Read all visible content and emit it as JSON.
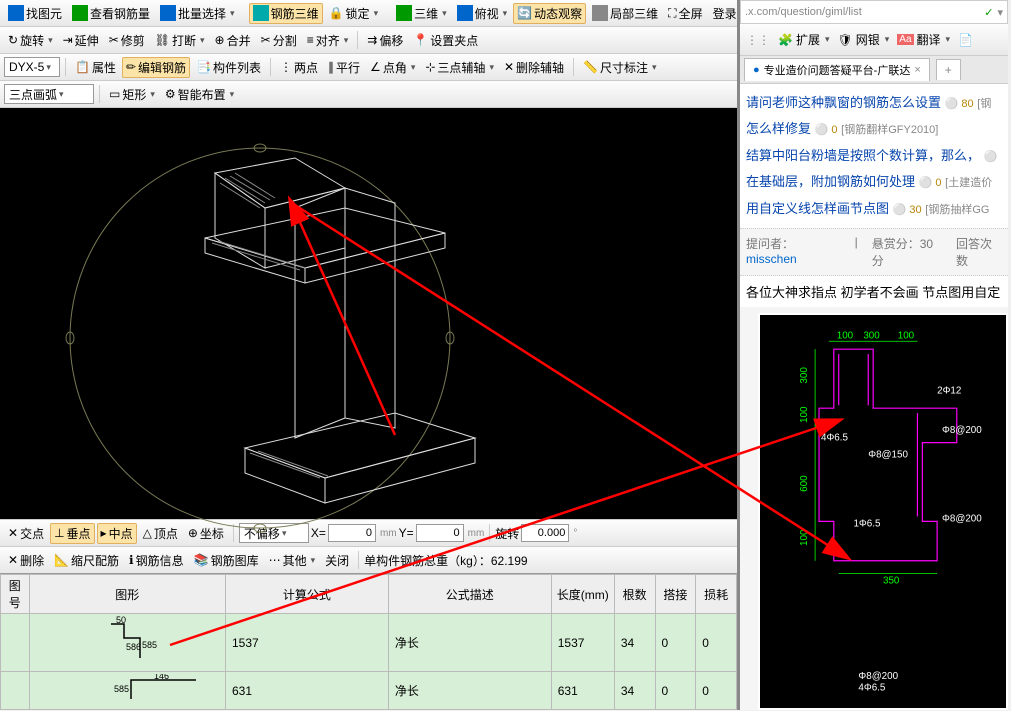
{
  "toolbar1": {
    "findView": "找图元",
    "viewRebar": "查看钢筋量",
    "batchSelect": "批量选择",
    "rebar3d": "钢筋三维",
    "lock": "锁定",
    "3d": "三维",
    "topView": "俯视",
    "dynObserve": "动态观察",
    "local3d": "局部三维",
    "fullScreen": "全屏",
    "login": "登录"
  },
  "toolbar2": {
    "rotate": "旋转",
    "extend": "延伸",
    "trim": "修剪",
    "break": "打断",
    "merge": "合并",
    "split": "分割",
    "align": "对齐",
    "offset": "偏移",
    "setClamp": "设置夹点"
  },
  "toolbar3": {
    "selector": "DYX-5",
    "attr": "属性",
    "editRebar": "编辑钢筋",
    "memberList": "构件列表",
    "twoPoint": "两点",
    "parallel": "平行",
    "pointAngle": "点角",
    "threePointAxis": "三点辅轴",
    "deleteAux": "删除辅轴",
    "dimMark": "尺寸标注"
  },
  "toolbar4": {
    "threePointArc": "三点画弧",
    "rect": "矩形",
    "smartArrange": "智能布置"
  },
  "snap": {
    "intersect": "交点",
    "perp": "垂点",
    "midpoint": "中点",
    "vertex": "顶点",
    "coord": "坐标",
    "noOffset": "不偏移",
    "x": "X=",
    "xval": "0",
    "y": "Y=",
    "yval": "0",
    "rot": "旋转",
    "rotval": "0.000",
    "mm": "mm"
  },
  "infobar": {
    "delete": "删除",
    "rulerMatch": "缩尺配筋",
    "rebarInfo": "钢筋信息",
    "rebarLib": "钢筋图库",
    "other": "其他",
    "close": "关闭",
    "totalLabel": "单构件钢筋总重（kg）：",
    "totalVal": "62.199"
  },
  "table": {
    "headers": [
      "图号",
      "图形",
      "计算公式",
      "公式描述",
      "长度(mm)",
      "根数",
      "搭接",
      "损耗"
    ],
    "rows": [
      {
        "formula": "1537",
        "desc": "净长",
        "len": "1537",
        "count": "34",
        "lap": "0",
        "loss": "0",
        "shapeTop": "50",
        "shapeSide": "585",
        "shapeSide2": "586"
      },
      {
        "formula": "631",
        "desc": "净长",
        "len": "631",
        "count": "34",
        "lap": "0",
        "loss": "0",
        "shapeSide": "585",
        "shapeTop": "146"
      }
    ]
  },
  "right": {
    "url": ".x.com/question/giml/list",
    "expand": "扩展",
    "netSilver": "网银",
    "translate": "翻译",
    "tabTitle": "专业造价问题答疑平台-广联达",
    "qa": [
      {
        "t": "请问老师这种飘窗的钢筋怎么设置",
        "c": "80",
        "tag": "[钢"
      },
      {
        "t": "怎么样修复",
        "c": "0",
        "tag": "[钢筋翻样GFY2010]"
      },
      {
        "t": "结算中阳台粉墙是按照个数计算，那么，",
        "c": "",
        "tag": ""
      },
      {
        "t": "在基础层，附加钢筋如何处理",
        "c": "0",
        "tag": "[土建造价"
      },
      {
        "t": "用自定义线怎样画节点图",
        "c": "30",
        "tag": "[钢筋抽样GG"
      }
    ],
    "askerLabel": "提问者：",
    "asker": "misschen",
    "bountyLabel": "悬赏分：",
    "bounty": "30分",
    "answerCount": "回答次数",
    "body": "各位大神求指点 初学者不会画 节点图用自定",
    "dims": {
      "d100a": "100",
      "d300": "300",
      "d100b": "100",
      "d300v": "300",
      "d100v": "100",
      "d600": "600",
      "d100v2": "100",
      "d350": "350",
      "r212": "2Φ12",
      "r465": "4Φ6.5",
      "r8150": "Φ8@150",
      "r8200a": "Φ8@200",
      "r8200b": "Φ8@200",
      "r165": "1Φ6.5",
      "r8200c": "Φ8@200",
      "r465b": "4Φ6.5"
    }
  }
}
